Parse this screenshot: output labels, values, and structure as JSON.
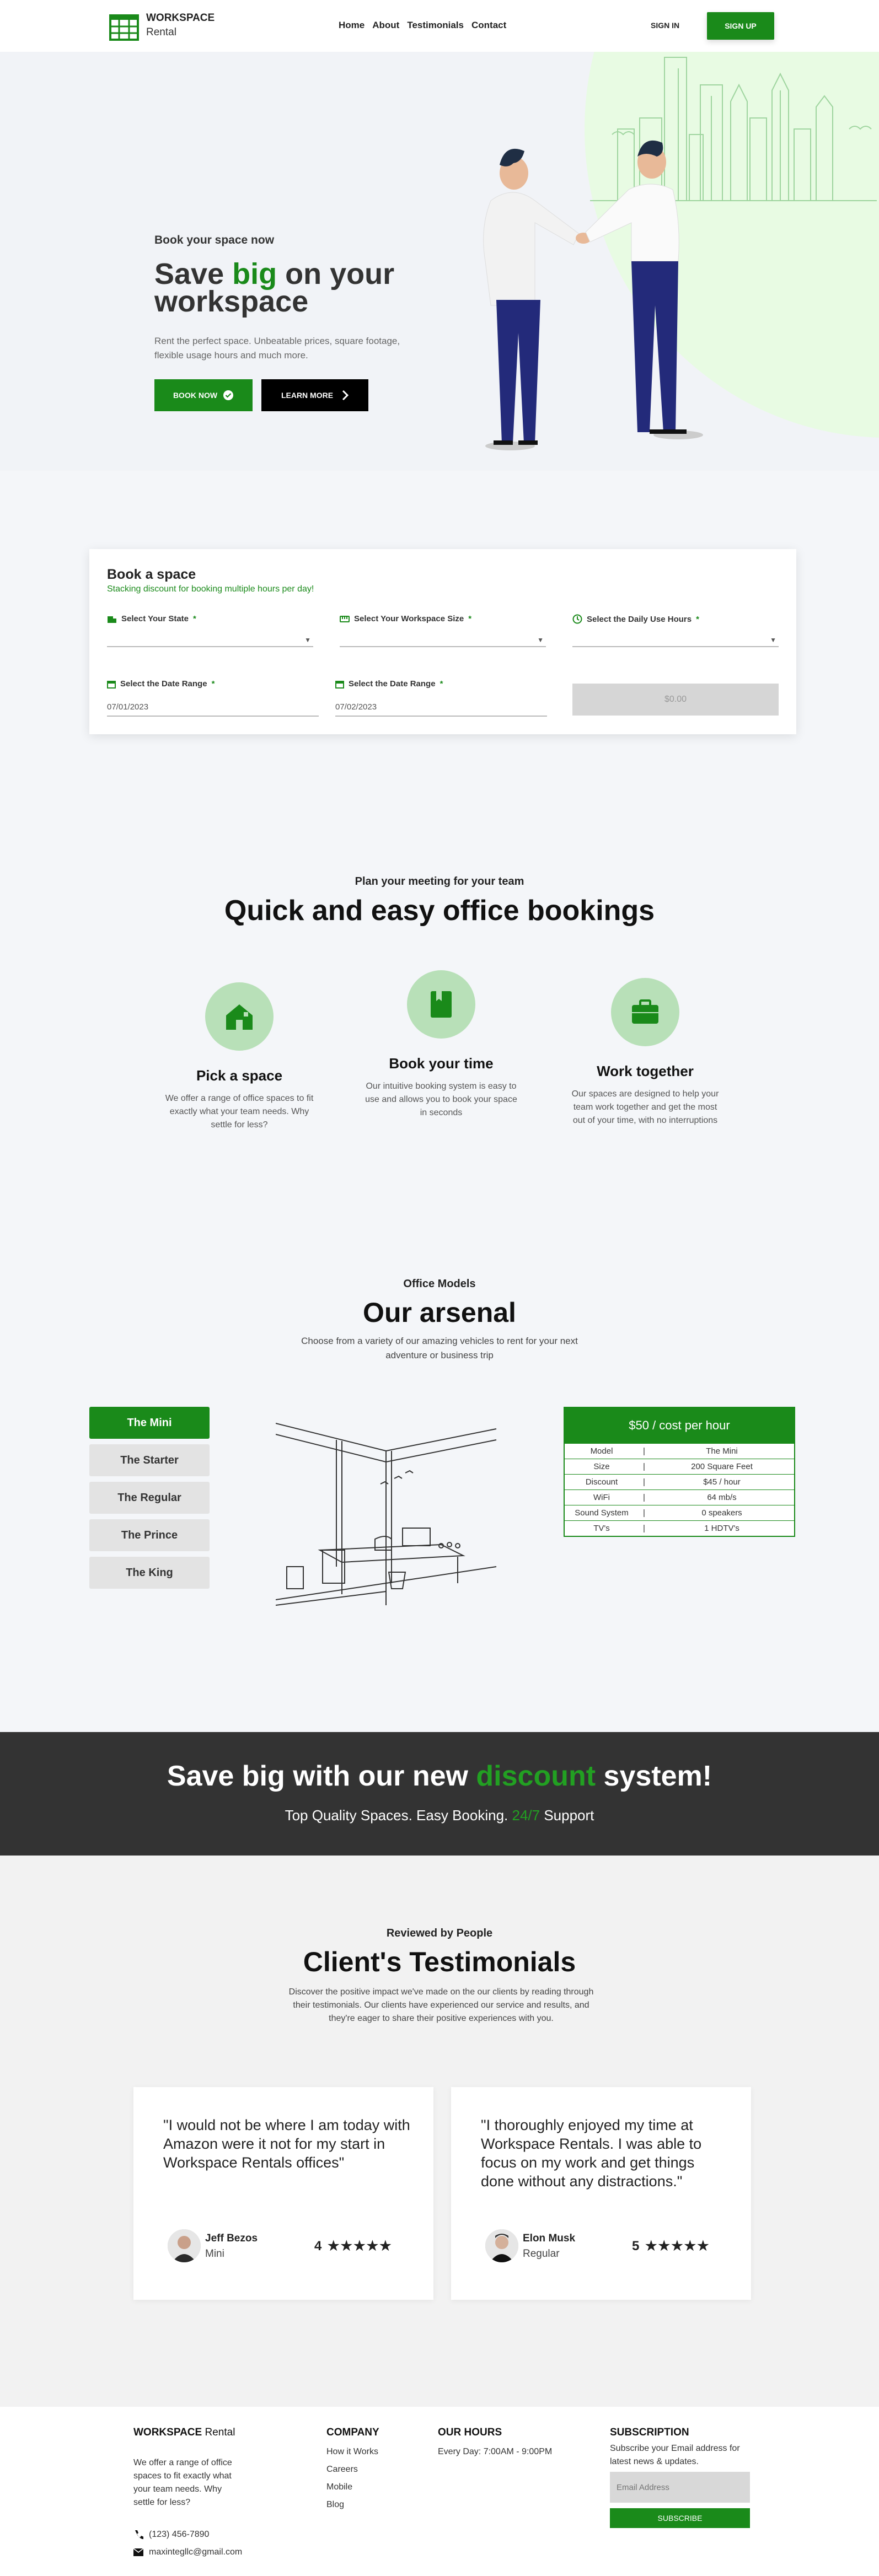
{
  "nav": {
    "logo_title": "WORKSPACE",
    "logo_sub": "Rental",
    "links": [
      "Home",
      "About",
      "Testimonials",
      "Contact"
    ],
    "signin": "SIGN IN",
    "signup": "SIGN UP"
  },
  "hero": {
    "eyebrow": "Book your space now",
    "title_pre": "Save ",
    "title_highlight": "big",
    "title_post": " on your workspace",
    "description": "Rent the perfect space. Unbeatable prices, square footage, flexible usage hours and much more.",
    "book_now": "BOOK NOW",
    "learn_more": "LEARN MORE"
  },
  "booking": {
    "title": "Book a space",
    "subtitle": "Stacking discount for booking multiple hours per day!",
    "state_label": "Select Your State",
    "size_label": "Select Your Workspace Size",
    "hours_label": "Select the Daily Use Hours",
    "date_label_1": "Select the Date Range",
    "date_label_2": "Select the Date Range",
    "required_mark": "*",
    "date_value_1": "07/01/2023",
    "date_value_2": "07/02/2023",
    "price": "$0.00"
  },
  "features": {
    "eyebrow": "Plan your meeting for your team",
    "title": "Quick and easy office bookings",
    "items": [
      {
        "title": "Pick a space",
        "desc": "We offer a range of office spaces to fit exactly what your team needs. Why settle for less?"
      },
      {
        "title": "Book your time",
        "desc": "Our intuitive booking system is easy to use and allows you to book your space in seconds"
      },
      {
        "title": "Work together",
        "desc": "Our spaces are designed to help your team work together and get the most out of your time, with no interruptions"
      }
    ]
  },
  "arsenal": {
    "eyebrow": "Office Models",
    "title": "Our arsenal",
    "description": "Choose from a variety of our amazing vehicles to rent for your next adventure or business trip",
    "models": [
      "The Mini",
      "The Starter",
      "The Regular",
      "The Prince",
      "The King"
    ],
    "price_header": "$50 / cost per hour",
    "separator": "|",
    "specs": [
      {
        "key": "Model",
        "value": "The Mini"
      },
      {
        "key": "Size",
        "value": "200 Square Feet"
      },
      {
        "key": "Discount",
        "value": "$45 / hour"
      },
      {
        "key": "WiFi",
        "value": "64 mb/s"
      },
      {
        "key": "Sound System",
        "value": "0 speakers"
      },
      {
        "key": "TV's",
        "value": "1 HDTV's"
      }
    ]
  },
  "banner": {
    "title_pre": "Save big with our new ",
    "title_highlight": "discount",
    "title_post": " system!",
    "sub_pre": "Top Quality Spaces. Easy Booking. ",
    "sub_highlight": "24/7",
    "sub_post": " Support"
  },
  "testimonials": {
    "eyebrow": "Reviewed by People",
    "title": "Client's Testimonials",
    "description": "Discover the positive impact we've made on the our clients by reading through their testimonials. Our clients have experienced our service and results, and they're eager to share their positive experiences with you.",
    "items": [
      {
        "quote": "\"I would not be where I am today with Amazon were it not for my start in Workspace Rentals offices\"",
        "name": "Jeff Bezos",
        "role": "Mini",
        "rating": "4",
        "stars": "★★★★★"
      },
      {
        "quote": "\"I thoroughly enjoyed my time at Workspace Rentals. I was able to focus on my work and get things done without any distractions.\"",
        "name": "Elon Musk",
        "role": "Regular",
        "rating": "5",
        "stars": "★★★★★"
      }
    ]
  },
  "footer": {
    "brand_title": "WORKSPACE",
    "brand_sub": "Rental",
    "brand_desc": "We offer a range of office spaces to fit exactly what your team needs. Why settle for less?",
    "phone": "(123) 456-7890",
    "email": "maxintegllc@gmail.com",
    "company_title": "COMPANY",
    "company_links": [
      "How it Works",
      "Careers",
      "Mobile",
      "Blog"
    ],
    "hours_title": "OUR HOURS",
    "hours_text": "Every Day: 7:00AM - 9:00PM",
    "subscription_title": "SUBSCRIPTION",
    "subscription_text": "Subscribe your Email address for latest news & updates.",
    "email_placeholder": "Email Address",
    "subscribe_button": "SUBSCRIBE"
  }
}
